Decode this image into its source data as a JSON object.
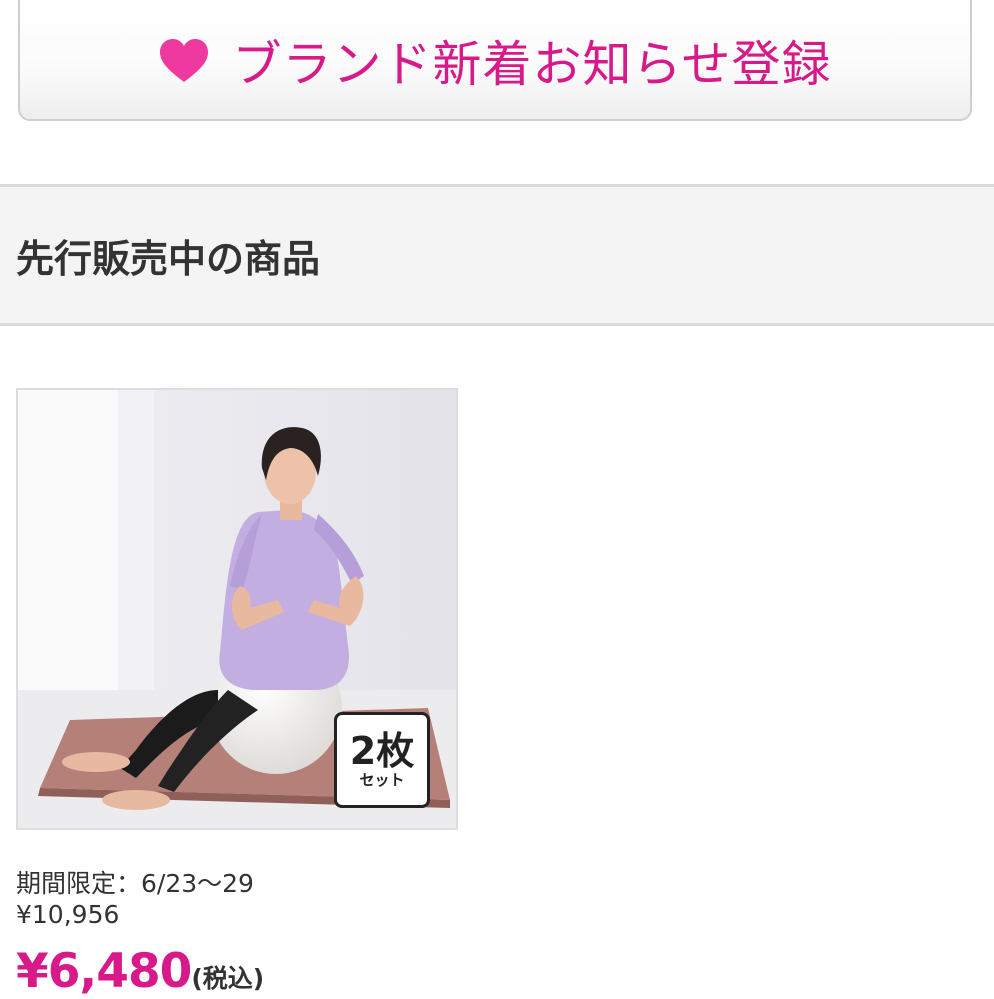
{
  "register": {
    "label": "ブランド新着お知らせ登録",
    "icon": "heart-icon",
    "color": "#d8198a"
  },
  "section": {
    "title": "先行販売中の商品"
  },
  "product": {
    "image_alt": "ヨガボールに座る女性",
    "badge_count": "2枚",
    "badge_unit": "セット",
    "period": "期間限定：6/23〜29",
    "original_price": "¥10,956",
    "sale_price": "¥6,480",
    "tax_label": "(税込)"
  }
}
